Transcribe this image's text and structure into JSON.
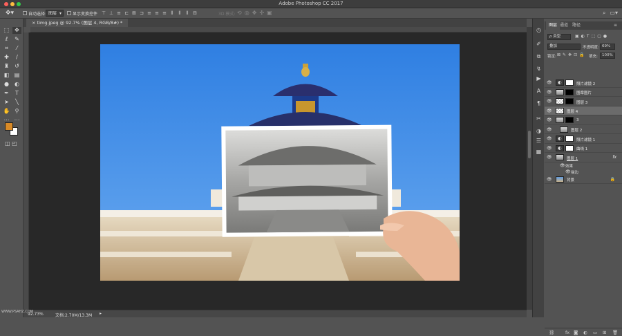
{
  "window": {
    "title": "Adobe Photoshop CC 2017"
  },
  "options_bar": {
    "auto_select_label": "自动选择:",
    "auto_select_value": "图层",
    "show_transform_label": "显示变换控件",
    "mode_3d_label": "3D 模式:"
  },
  "document": {
    "tab_label": "timg.jpeg @ 92.7% (图层 4, RGB/8#) *",
    "zoom": "92.73%",
    "doc_size": "文档:2.70M/13.3M"
  },
  "colors": {
    "foreground": "#d88a27",
    "background": "#ffffff"
  },
  "watermark": "WWW.PSAHZ.COM",
  "layers_panel": {
    "tabs": [
      "图层",
      "通道",
      "路径"
    ],
    "filter_label": "ρ 类型",
    "blend_mode": "叠加",
    "opacity_label": "不透明度:",
    "opacity_value": "69%",
    "lock_label": "锁定:",
    "fill_label": "填充:",
    "fill_value": "100%",
    "layers": [
      {
        "name": "照片滤镜 2",
        "kind": "adjustment"
      },
      {
        "name": "图章图片",
        "kind": "image"
      },
      {
        "name": "图层 3",
        "kind": "image"
      },
      {
        "name": "图层 4",
        "kind": "image"
      },
      {
        "name": "3",
        "kind": "image"
      },
      {
        "name": "图层 2",
        "kind": "image"
      },
      {
        "name": "照片滤镜 1",
        "kind": "adjustment"
      },
      {
        "name": "曲线 1",
        "kind": "adjustment"
      },
      {
        "name": "图层 1",
        "kind": "image"
      },
      {
        "name": "背景",
        "kind": "image"
      }
    ],
    "effects_label": "效果",
    "stroke_label": "描边",
    "fx_label": "fx"
  }
}
